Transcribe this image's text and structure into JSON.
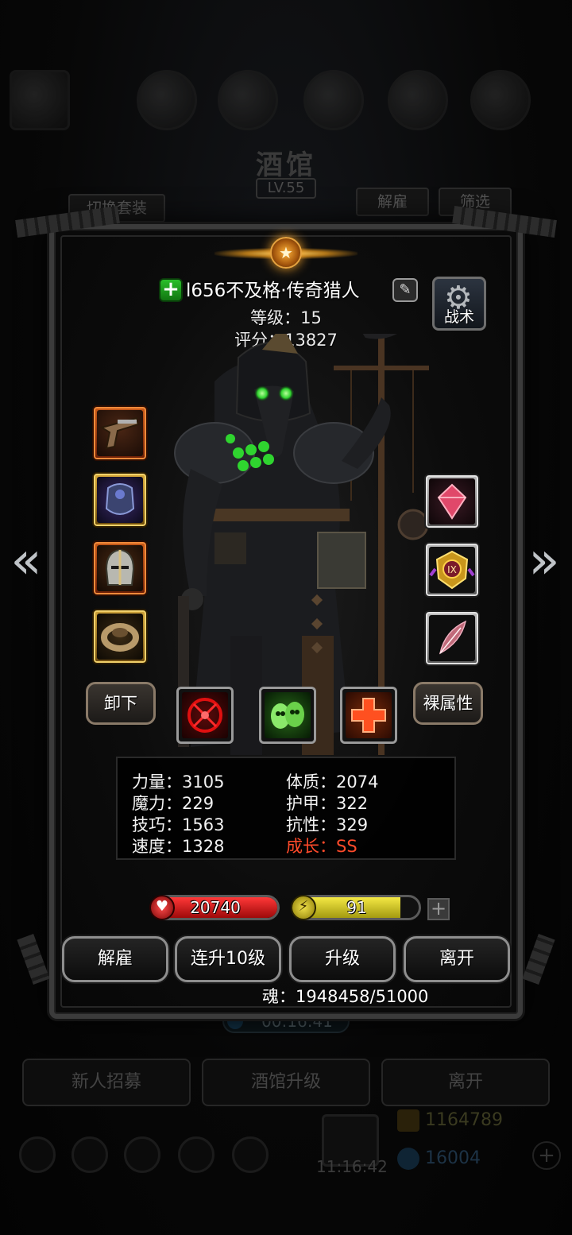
{
  "background": {
    "title": "酒馆",
    "level": "LV.55",
    "switch_outfit": "切换套装",
    "dismiss": "解雇",
    "filter": "筛选",
    "timer": "00:16:41",
    "bottom_buttons": [
      "新人招募",
      "酒馆升级",
      "离开"
    ],
    "gold": "1164789",
    "gems": "16004",
    "clock": "11:16:42"
  },
  "hero": {
    "name": "l656不及格·传奇猎人",
    "level_line": "等级：15",
    "score_line": "评分：13827",
    "tactics_label": "战术"
  },
  "equipment": {
    "left": [
      {
        "slot": "weapon",
        "icon": "pistol-icon",
        "rarity": "red"
      },
      {
        "slot": "armor",
        "icon": "armor-icon",
        "rarity": "purple"
      },
      {
        "slot": "helmet",
        "icon": "helmet-icon",
        "rarity": "red"
      },
      {
        "slot": "ring",
        "icon": "ring-icon",
        "rarity": "gold"
      }
    ],
    "right": [
      {
        "slot": "gem",
        "icon": "gem-icon",
        "rarity": "grey"
      },
      {
        "slot": "badge",
        "icon": "badge-icon",
        "rarity": "grey"
      },
      {
        "slot": "feather",
        "icon": "feather-icon",
        "rarity": "grey"
      }
    ]
  },
  "buttons": {
    "unequip": "卸下",
    "bare_attributes": "裸属性"
  },
  "skills": [
    {
      "icon": "target-skill-icon"
    },
    {
      "icon": "ghost-skill-icon"
    },
    {
      "icon": "heal-cross-skill-icon"
    }
  ],
  "stats": {
    "strength": "力量：3105",
    "magic": "魔力：229",
    "skill": "技巧：1563",
    "speed": "速度：1328",
    "constitution": "体质：2074",
    "armor": "护甲：322",
    "resistance": "抗性：329",
    "growth": "成长：SS"
  },
  "bars": {
    "hp": "20740",
    "energy": "91",
    "energy_level": 0.85
  },
  "actions": {
    "dismiss": "解雇",
    "level_up_10": "连升10级",
    "level_up": "升级",
    "leave": "离开"
  },
  "soul": "魂：1948458/51000",
  "colors": {
    "growth": "#ff4a2a",
    "hp": "#d81414",
    "energy": "#e3d520"
  }
}
